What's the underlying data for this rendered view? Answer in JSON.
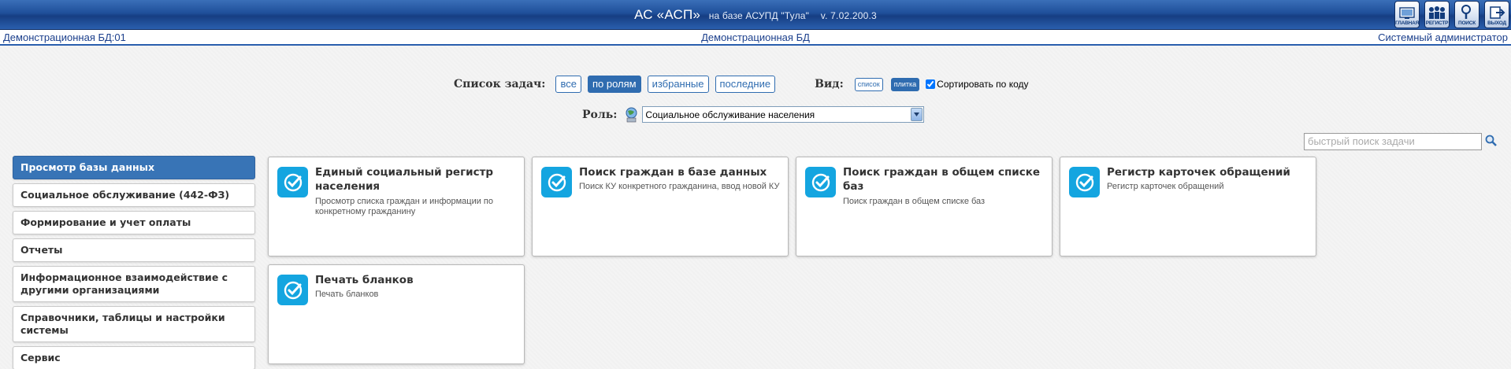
{
  "header": {
    "title_main": "АС «АСП»",
    "title_sub": "на базе АСУПД \"Тула\"",
    "version": "v. 7.02.200.3",
    "buttons": [
      {
        "label": "главная",
        "icon": "home-icon"
      },
      {
        "label": "регистр",
        "icon": "registry-icon"
      },
      {
        "label": "поиск",
        "icon": "search-icon"
      },
      {
        "label": "выход",
        "icon": "exit-icon"
      }
    ]
  },
  "infoline": {
    "left": "Демонстрационная БД:01",
    "center": "Демонстрационная БД",
    "right": "Системный администратор"
  },
  "tasks": {
    "label": "Список задач:",
    "filters": [
      "все",
      "по ролям",
      "избранные",
      "последние"
    ],
    "active_filter": "по ролям"
  },
  "view": {
    "label": "Вид:",
    "options": [
      "список",
      "плитка"
    ],
    "active": "плитка",
    "sort_label": "Сортировать по коду",
    "sort_checked": true
  },
  "role": {
    "label": "Роль:",
    "value": "Социальное обслуживание населения"
  },
  "search": {
    "placeholder": "быстрый поиск задачи"
  },
  "sidebar": {
    "items": [
      {
        "label": "Просмотр базы данных",
        "active": true
      },
      {
        "label": "Социальное обслуживание (442-ФЗ)",
        "active": false
      },
      {
        "label": "Формирование и учет оплаты",
        "active": false
      },
      {
        "label": "Отчеты",
        "active": false
      },
      {
        "label": "Информационное взаимодействие с другими организациями",
        "active": false
      },
      {
        "label": "Справочники, таблицы и настройки системы",
        "active": false
      },
      {
        "label": "Сервис",
        "active": false
      }
    ]
  },
  "cards": [
    {
      "title": "Единый социальный регистр населения",
      "desc": "Просмотр списка граждан и информации по конкретному гражданину"
    },
    {
      "title": "Поиск граждан в базе данных",
      "desc": "Поиск КУ конкретного гражданина, ввод новой КУ"
    },
    {
      "title": "Поиск граждан в общем списке баз",
      "desc": "Поиск граждан в общем списке баз"
    },
    {
      "title": "Регистр карточек обращений",
      "desc": "Регистр карточек обращений"
    },
    {
      "title": "Печать бланков",
      "desc": "Печать бланков"
    }
  ],
  "colors": {
    "header_blue": "#1f4f9a",
    "accent": "#2f6cb0",
    "tile_icon": "#14a5e0"
  }
}
